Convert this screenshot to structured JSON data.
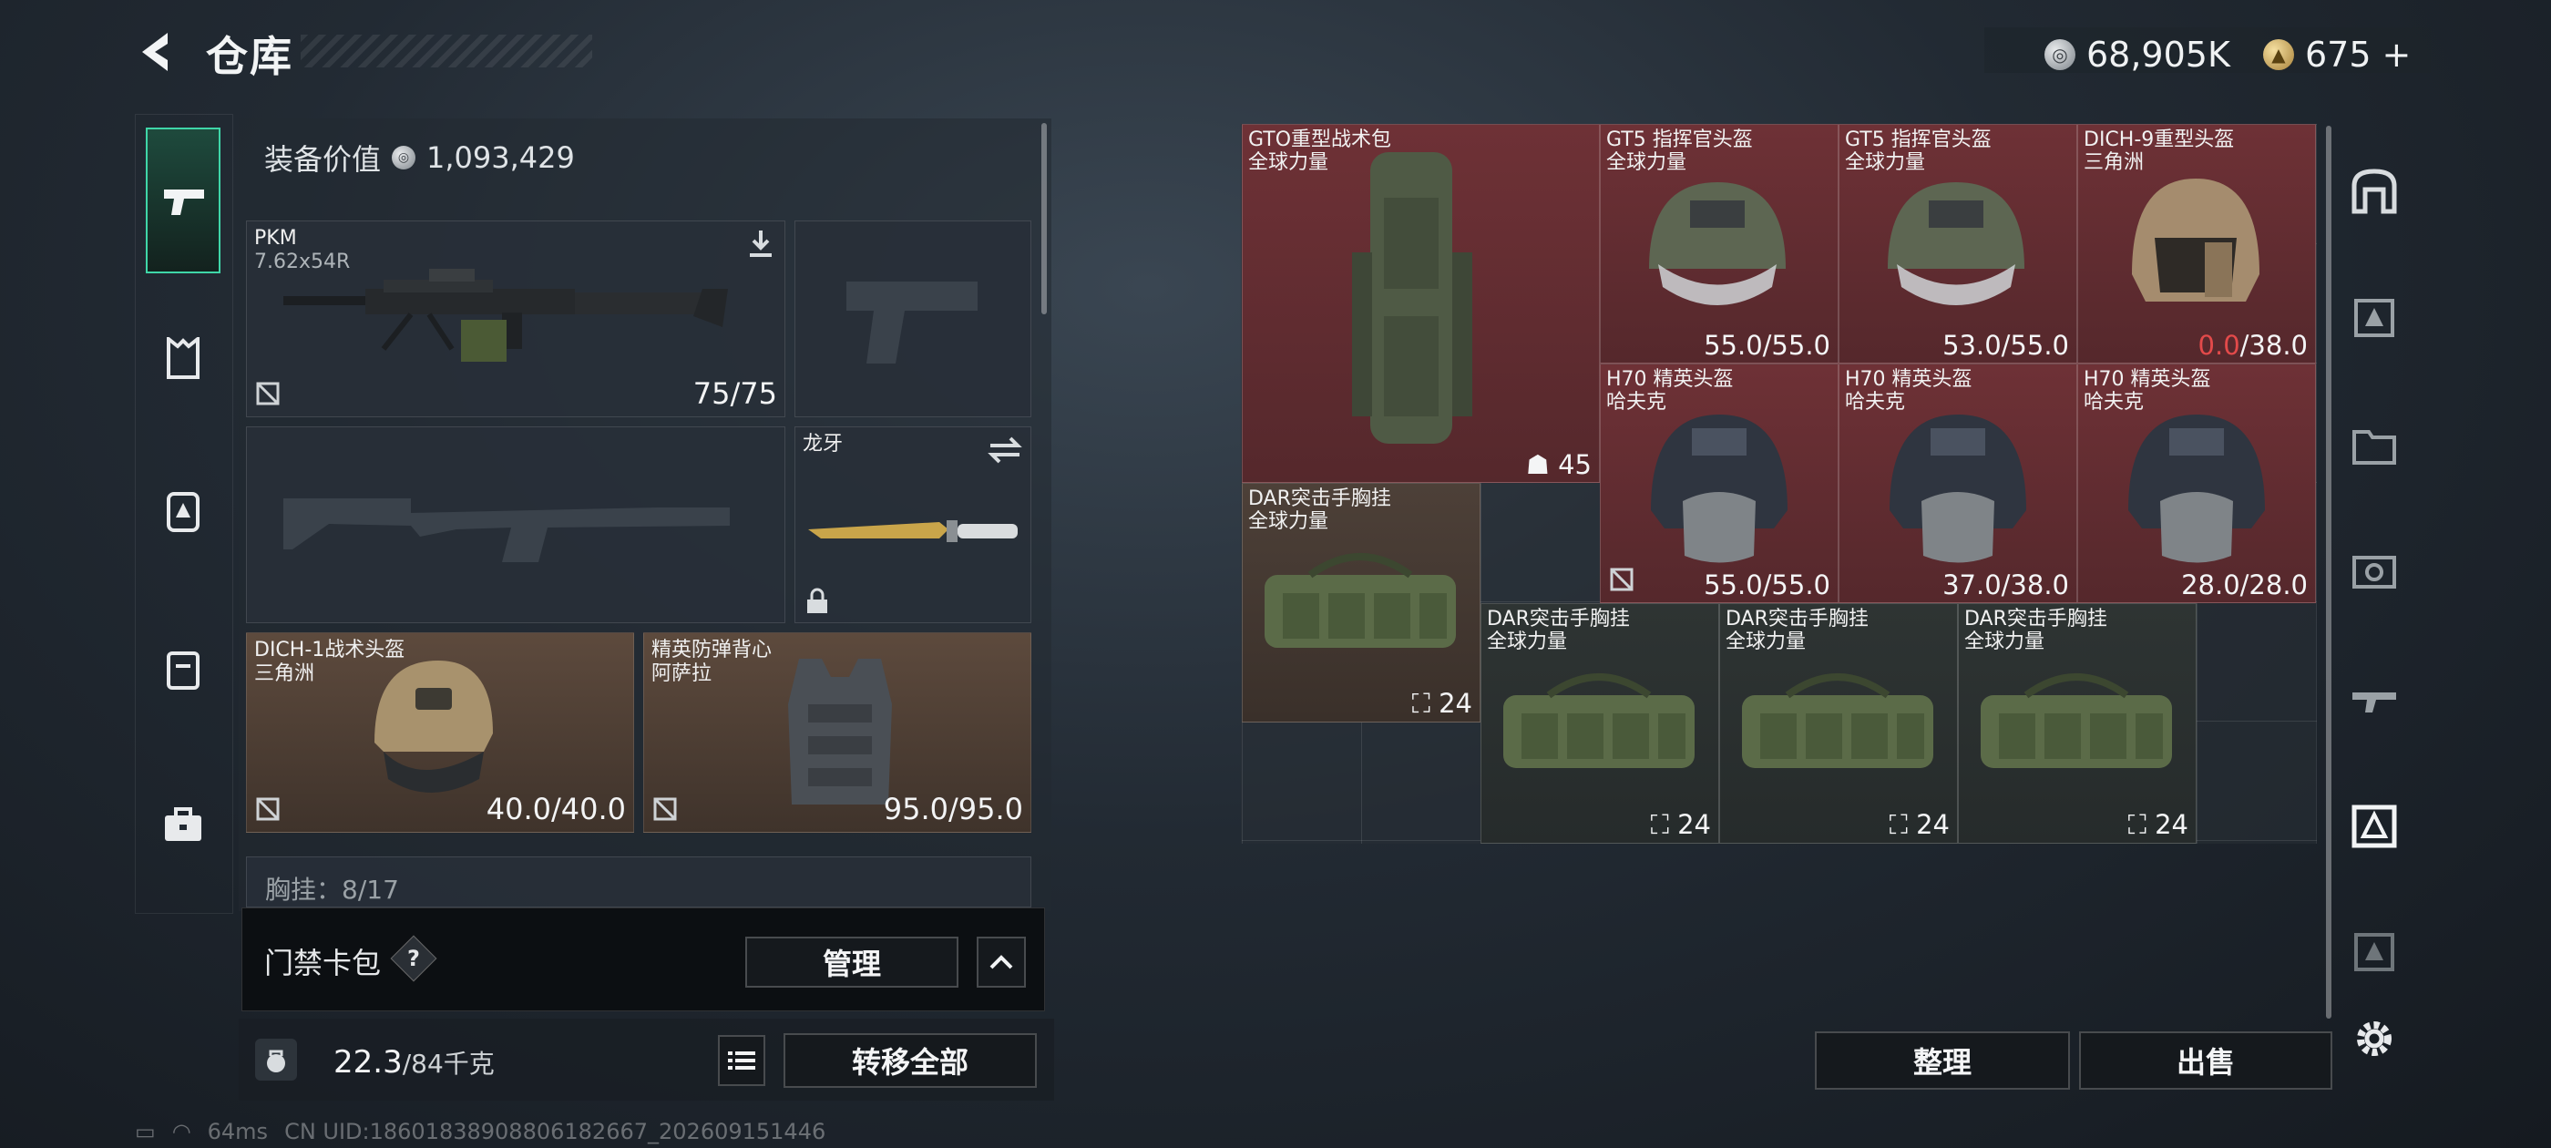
{
  "header": {
    "title": "仓库",
    "silver_amount": "68,905K",
    "gold_amount": "675",
    "add_label": "+"
  },
  "equipment": {
    "value_label": "装备价值",
    "value_amount": "1,093,429",
    "primary": {
      "name": "PKM",
      "caliber": "7.62x54R",
      "ammo": "75/75"
    },
    "knife": {
      "name": "龙牙"
    },
    "helmet": {
      "name": "DICH-1战术头盔",
      "brand": "三角洲",
      "durability": "40.0/40.0"
    },
    "armor": {
      "name": "精英防弹背心",
      "brand": "阿萨拉",
      "durability": "95.0/95.0"
    },
    "chest_rig_peek": "胸挂：8/17"
  },
  "keycard": {
    "label": "门禁卡包",
    "help": "?",
    "manage_button": "管理"
  },
  "weight": {
    "current": "22.3",
    "max_unit": "/84千克",
    "transfer_button": "转移全部"
  },
  "stash": {
    "items": [
      {
        "name": "GTO重型战术包",
        "brand": "全球力量",
        "count": "45"
      },
      {
        "name": "GT5 指挥官头盔",
        "brand": "全球力量",
        "dura_value": "55.0",
        "dura_max": "/55.0"
      },
      {
        "name": "GT5 指挥官头盔",
        "brand": "全球力量",
        "dura_value": "53.0",
        "dura_max": "/55.0"
      },
      {
        "name": "DICH-9重型头盔",
        "brand": "三角洲",
        "dura_value": "0.0",
        "dura_max": "/38.0"
      },
      {
        "name": "H70 精英头盔",
        "brand": "哈夫克",
        "dura_value": "55.0",
        "dura_max": "/55.0"
      },
      {
        "name": "H70 精英头盔",
        "brand": "哈夫克",
        "dura_value": "37.0",
        "dura_max": "/38.0"
      },
      {
        "name": "H70 精英头盔",
        "brand": "哈夫克",
        "dura_value": "28.0",
        "dura_max": "/28.0"
      },
      {
        "name": "DAR突击手胸挂",
        "brand": "全球力量",
        "count": "24"
      },
      {
        "name": "DAR突击手胸挂",
        "brand": "全球力量",
        "count": "24"
      },
      {
        "name": "DAR突击手胸挂",
        "brand": "全球力量",
        "count": "24"
      },
      {
        "name": "DAR突击手胸挂",
        "brand": "全球力量",
        "count": "24"
      }
    ],
    "sort_button": "整理",
    "sell_button": "出售"
  },
  "status": {
    "ping": "64ms",
    "uid": "CN UID:18601838908806182667_202609151446"
  },
  "colors": {
    "accent": "#3fd6a8",
    "item_red": "#6e3136",
    "item_brown": "#4d4038",
    "low_durability": "#e34a4a"
  }
}
